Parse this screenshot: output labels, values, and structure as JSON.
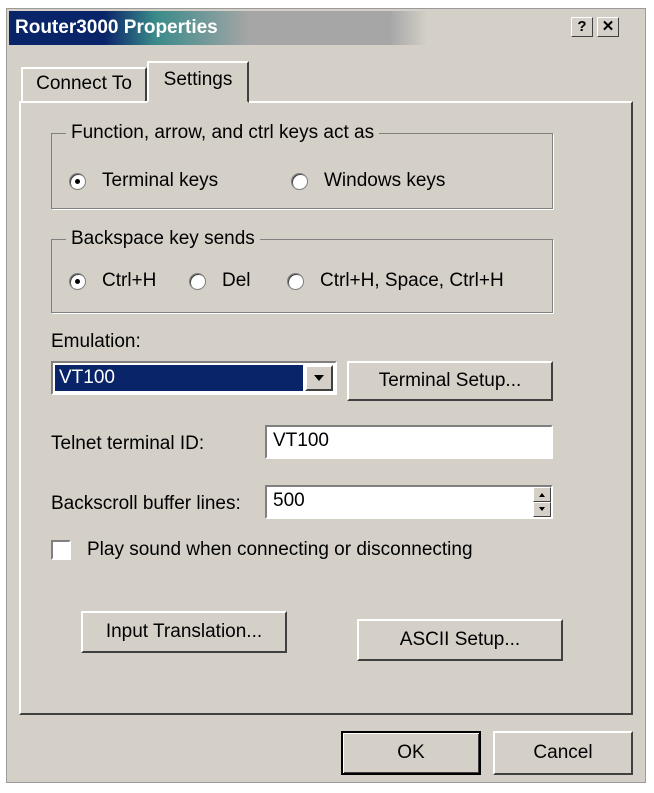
{
  "window": {
    "title": "Router3000 Properties",
    "help_glyph": "?",
    "close_glyph": "✕"
  },
  "tabs": [
    {
      "label": "Connect To",
      "active": false
    },
    {
      "label": "Settings",
      "active": true
    }
  ],
  "function_keys": {
    "legend": "Function, arrow, and ctrl keys act as",
    "options": [
      {
        "label": "Terminal keys",
        "selected": true
      },
      {
        "label": "Windows keys",
        "selected": false
      }
    ]
  },
  "backspace": {
    "legend": "Backspace key sends",
    "options": [
      {
        "label": "Ctrl+H",
        "selected": true
      },
      {
        "label": "Del",
        "selected": false
      },
      {
        "label": "Ctrl+H, Space, Ctrl+H",
        "selected": false
      }
    ]
  },
  "emulation": {
    "label": "Emulation:",
    "value": "VT100",
    "dropdown_icon": "chevron-down-icon",
    "setup_button": "Terminal Setup..."
  },
  "telnet": {
    "label": "Telnet terminal ID:",
    "value": "VT100"
  },
  "backscroll": {
    "label": "Backscroll buffer lines:",
    "value": "500"
  },
  "sound": {
    "label": "Play sound when connecting or disconnecting",
    "checked": false
  },
  "buttons": {
    "input_translation": "Input Translation...",
    "ascii_setup": "ASCII Setup...",
    "ok": "OK",
    "cancel": "Cancel"
  },
  "colors": {
    "dialog_bg": "#d4d0c8",
    "title_active": "#0a246a",
    "selection": "#0a246a"
  }
}
